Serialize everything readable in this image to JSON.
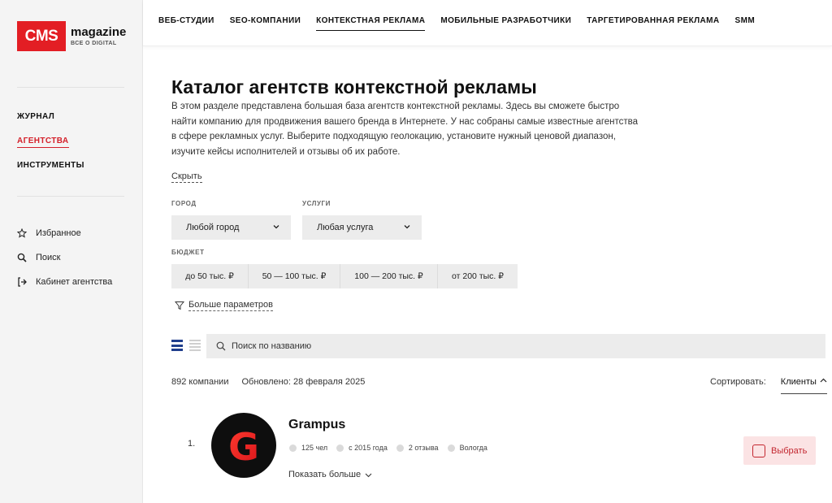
{
  "logo": {
    "box_text": "CMS",
    "name": "magazine",
    "tagline": "ВСЕ О DIGITAL"
  },
  "sidebar": {
    "nav": [
      {
        "label": "ЖУРНАЛ",
        "active": false
      },
      {
        "label": "АГЕНТСТВА",
        "active": true
      },
      {
        "label": "ИНСТРУМЕНТЫ",
        "active": false
      }
    ],
    "links": [
      {
        "label": "Избранное",
        "icon": "star-icon"
      },
      {
        "label": "Поиск",
        "icon": "search-icon"
      },
      {
        "label": "Кабинет агентства",
        "icon": "login-icon"
      }
    ]
  },
  "topnav": [
    {
      "label": "ВЕБ-СТУДИИ",
      "active": false
    },
    {
      "label": "SEO-КОМПАНИИ",
      "active": false
    },
    {
      "label": "КОНТЕКСТНАЯ РЕКЛАМА",
      "active": true
    },
    {
      "label": "МОБИЛЬНЫЕ РАЗРАБОТЧИКИ",
      "active": false
    },
    {
      "label": "ТАРГЕТИРОВАННАЯ РЕКЛАМА",
      "active": false
    },
    {
      "label": "SMM",
      "active": false
    }
  ],
  "page": {
    "title": "Каталог агентств контекстной рекламы",
    "description": "В этом разделе представлена большая база агентств контекстной рекламы. Здесь вы сможете быстро найти компанию для продвижения вашего бренда в Интернете. У нас собраны самые известные агентства в сфере рекламных услуг. Выберите подходящую геолокацию, установите нужный ценовой диапазон, изучите кейсы исполнителей и отзывы об их работе.",
    "hide_label": "Скрыть"
  },
  "filters": {
    "city_label": "ГОРОД",
    "city_value": "Любой город",
    "services_label": "УСЛУГИ",
    "services_value": "Любая услуга",
    "budget_label": "БЮДЖЕТ",
    "budget_options": [
      "до 50 тыс. ₽",
      "50 — 100 тыс. ₽",
      "100 — 200 тыс. ₽",
      "от 200 тыс. ₽"
    ],
    "more_label": "Больше параметров"
  },
  "search": {
    "placeholder": "Поиск по названию"
  },
  "results": {
    "count": "892 компании",
    "updated": "Обновлено: 28 февраля 2025",
    "sort_label": "Сортировать:",
    "sort_value": "Клиенты"
  },
  "companies": [
    {
      "num": "1.",
      "name": "Grampus",
      "logo_letter": "G",
      "employees": "125 чел",
      "since": "с 2015 года",
      "reviews": "2 отзыва",
      "city": "Вологда",
      "more_label": "Показать больше",
      "choose_label": "Выбрать"
    }
  ],
  "colors": {
    "brand_red": "#e31e24",
    "accent_blue": "#1f3e8c",
    "choose_bg": "#fbe3e4"
  }
}
